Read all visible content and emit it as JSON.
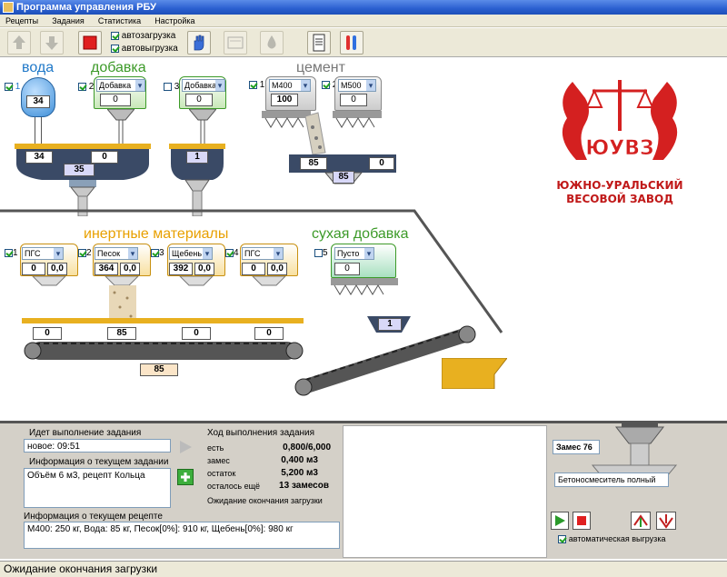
{
  "window": {
    "title": "Программа управления РБУ"
  },
  "menu": [
    "Рецепты",
    "Задания",
    "Статистика",
    "Настройка"
  ],
  "toolbar": {
    "autoload_label": "автозагрузка",
    "autounload_label": "автовыгрузка"
  },
  "sections": {
    "water": "вода",
    "additive": "добавка",
    "cement": "цемент",
    "inert": "инертные материалы",
    "dry": "сухая добавка"
  },
  "water": {
    "num": "1",
    "value": "34"
  },
  "additive1": {
    "num": "2",
    "select": "Добавка",
    "value": "0"
  },
  "additive2": {
    "num": "3",
    "select": "Добавка",
    "value": "0"
  },
  "scale_left": {
    "a": "34",
    "b": "0",
    "total": "35"
  },
  "scale_right": {
    "total": "1"
  },
  "cement1": {
    "num": "1",
    "select": "М400",
    "value": "100"
  },
  "cement2": {
    "num": "2",
    "select": "М500",
    "value": "0"
  },
  "cement_scale": {
    "a": "85",
    "b": "0",
    "total": "85"
  },
  "logo": {
    "abbr": "ЮУВЗ",
    "line1": "ЮЖНО-УРАЛЬСКИЙ",
    "line2": "ВЕСОВОЙ ЗАВОД"
  },
  "inert": [
    {
      "num": "1",
      "select": "ПГС",
      "value": "0",
      "moist": "0,0"
    },
    {
      "num": "2",
      "select": "Песок",
      "value": "364",
      "moist": "0,0"
    },
    {
      "num": "3",
      "select": "Щебень",
      "value": "392",
      "moist": "0,0"
    },
    {
      "num": "4",
      "select": "ПГС",
      "value": "0",
      "moist": "0,0"
    }
  ],
  "dry": {
    "num": "5",
    "select": "Пусто",
    "value": "0"
  },
  "belt": {
    "v1": "0",
    "v2": "85",
    "v3": "0",
    "v4": "0",
    "total": "85"
  },
  "skip": {
    "value": "1"
  },
  "task": {
    "exec_label": "Идет выполнение задания",
    "exec_value": "новое: 09:51",
    "info_label": "Информация о текущем задании",
    "info_value": "Объём 6 м3, рецепт Кольца",
    "recipe_label": "Информация о текущем рецепте",
    "recipe_value": "М400: 250 кг, Вода: 85 кг, Песок[0%]: 910 кг, Щебень[0%]: 980 кг"
  },
  "progress": {
    "title": "Ход выполнения задания",
    "rows": [
      {
        "label": "есть",
        "value": "0,800/6,000"
      },
      {
        "label": "замес",
        "value": "0,400 м3"
      },
      {
        "label": "остаток",
        "value": "5,200 м3"
      },
      {
        "label": "осталось ещё",
        "value": "13 замесов"
      }
    ],
    "wait": "Ожидание окончания загрузки"
  },
  "mixer": {
    "batch": "Замес 76",
    "status": "Бетоносмеситель полный",
    "auto_label": "автоматическая выгрузка"
  },
  "statusbar": "Ожидание окончания загрузки",
  "colors": {
    "water": "#3f8fd8",
    "additive": "#3c9a28",
    "belt_rail": "#e8b020",
    "logo_red": "#d42020"
  }
}
